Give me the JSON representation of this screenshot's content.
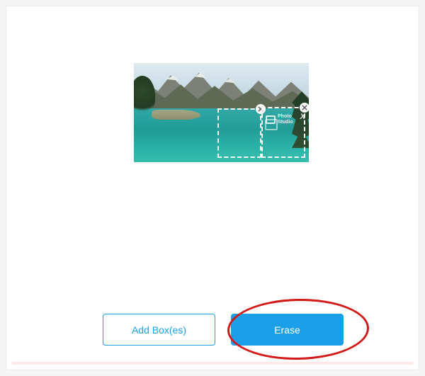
{
  "buttons": {
    "add_boxes": "Add Box(es)",
    "erase": "Erase"
  },
  "watermark": {
    "line1": "Photo",
    "line2": "Studio",
    "suffix": "X"
  },
  "selections": [
    {
      "id": "box-1"
    },
    {
      "id": "box-2"
    }
  ],
  "colors": {
    "primary": "#1a9fe8",
    "highlight": "#d31818"
  }
}
